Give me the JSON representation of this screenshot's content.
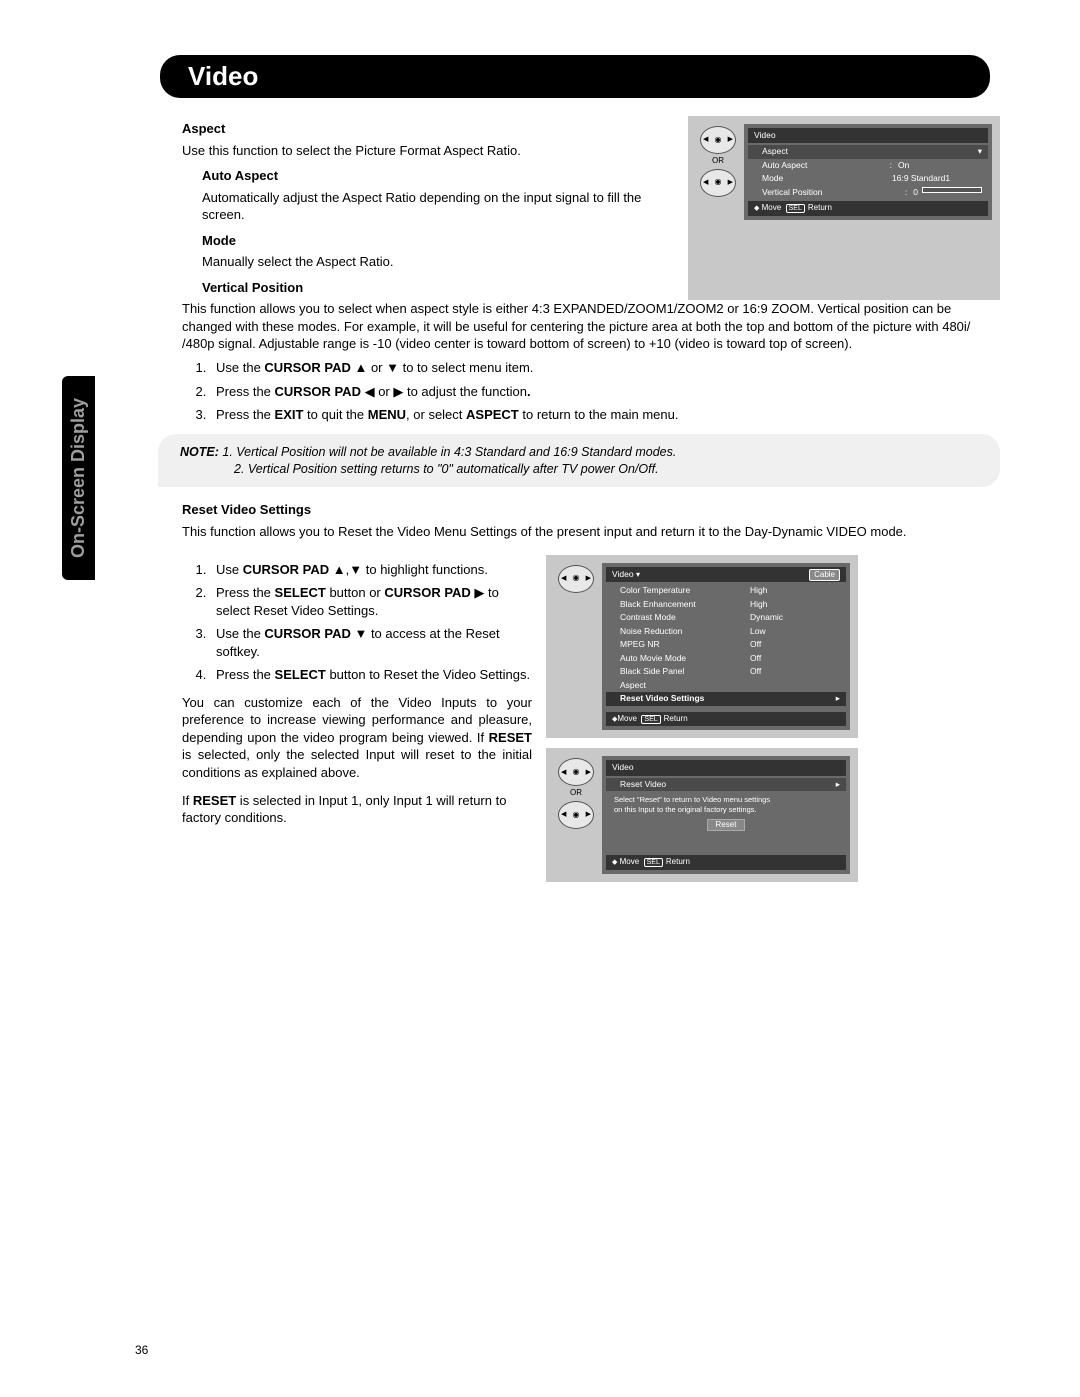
{
  "page_title": "Video",
  "side_tab": "On-Screen Display",
  "page_number": "36",
  "aspect": {
    "heading": "Aspect",
    "desc": "Use this function to select the Picture Format Aspect Ratio.",
    "auto_h": "Auto Aspect",
    "auto_desc": "Automatically adjust the Aspect Ratio depending on the input signal to fill the screen.",
    "mode_h": "Mode",
    "mode_desc": "Manually select the Aspect Ratio.",
    "vp_h": "Vertical Position",
    "vp_desc": "This function allows you to select when aspect style is either 4:3 EXPANDED/ZOOM1/ZOOM2 or 16:9 ZOOM.  Vertical position can be changed with these modes. For example, it will be useful for centering the picture area at both the top and bottom of the picture with 480i/ /480p signal.  Adjustable range is -10 (video center is toward bottom of screen) to +10 (video is toward top of screen)."
  },
  "steps_a": {
    "s1a": "Use the ",
    "s1b": "CURSOR PAD",
    "s1c": " ▲ or ▼ to to select menu item.",
    "s2a": "Press the ",
    "s2b": "CURSOR PAD",
    "s2c": " ◀ or ▶ to adjust the function",
    "s3a": "Press the ",
    "s3b": "EXIT",
    "s3c": " to quit the ",
    "s3d": "MENU",
    "s3e": ", or select ",
    "s3f": "ASPECT",
    "s3g": " to return to the main menu."
  },
  "note": {
    "label": "NOTE:",
    "n1": " 1. Vertical Position will not be available in 4:3 Standard and 16:9 Standard modes.",
    "n2": "2. Vertical Position setting returns to \"0\" automatically after TV power On/Off."
  },
  "reset": {
    "heading": "Reset Video Settings",
    "desc": "This function allows you to Reset the Video Menu Settings of the present input and return it to the Day-Dynamic VIDEO mode."
  },
  "steps_b": {
    "s1a": "Use ",
    "s1b": "CURSOR PAD",
    "s1c": " ▲,▼ to highlight functions.",
    "s2a": "Press the ",
    "s2b": "SELECT",
    "s2c": " button or ",
    "s2d": "CURSOR PAD",
    "s2e": " ▶ to select Reset Video Settings.",
    "s3a": "Use the ",
    "s3b": "CURSOR PAD",
    "s3c": " ▼ to access at the Reset softkey.",
    "s4a": "Press the ",
    "s4b": "SELECT",
    "s4c": " button to Reset the Video Settings."
  },
  "para1a": "You can customize each of the Video Inputs to your preference to increase viewing performance and pleasure, depending upon the video program being viewed. If ",
  "para1b": "RESET",
  "para1c": " is selected, only the selected Input will reset to the initial conditions as explained above.",
  "para2a": "If ",
  "para2b": "RESET",
  "para2c": " is selected in Input 1, only Input 1 will return to factory conditions.",
  "osd1": {
    "title": "Video",
    "r_aspect": "Aspect",
    "arrow": "▾",
    "r_auto": "Auto Aspect",
    "colon": ":",
    "v_auto": "On",
    "r_mode": "Mode",
    "v_mode": "16:9  Standard1",
    "r_vp": "Vertical Position",
    "v_vp": "0",
    "foot_move": "Move",
    "foot_sel": "SEL",
    "foot_ret": "Return",
    "or": "OR"
  },
  "osd2": {
    "title": "Video",
    "cable": "Cable",
    "rows": [
      {
        "l": "Color Temperature",
        "v": "High"
      },
      {
        "l": "Black Enhancement",
        "v": "High"
      },
      {
        "l": "Contrast Mode",
        "v": "Dynamic"
      },
      {
        "l": "Noise Reduction",
        "v": "Low"
      },
      {
        "l": "MPEG NR",
        "v": "Off"
      },
      {
        "l": "Auto Movie Mode",
        "v": "Off"
      },
      {
        "l": "Black Side Panel",
        "v": "Off"
      },
      {
        "l": "Aspect",
        "v": ""
      }
    ],
    "hl": "Reset Video Settings",
    "foot_move": "Move",
    "foot_sel": "SEL",
    "foot_ret": "Return"
  },
  "osd3": {
    "title": "Video",
    "row1": "Reset Video",
    "msg1": "Select \"Reset\" to return to Video menu settings",
    "msg2": "on this Input to the original factory settings.",
    "btn": "Reset",
    "foot_move": "Move",
    "foot_sel": "SEL",
    "foot_ret": "Return",
    "or": "OR"
  }
}
